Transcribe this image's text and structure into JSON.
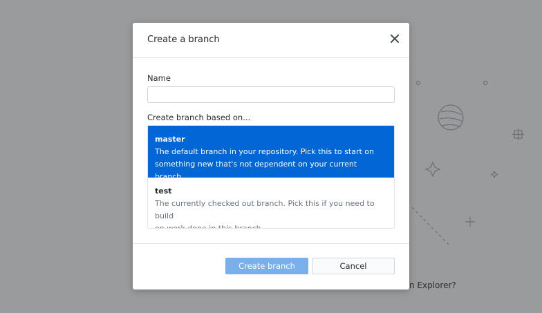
{
  "background": {
    "partial_text": "n Explorer?"
  },
  "dialog": {
    "title": "Create a branch",
    "close_icon": "close-icon",
    "name_label": "Name",
    "name_value": "",
    "based_on_label": "Create branch based on...",
    "branches": [
      {
        "name": "master",
        "description_line1": "The default branch in your repository. Pick this to start on",
        "description_line2": "something new that's not dependent on your current branch.",
        "selected": true
      },
      {
        "name": "test",
        "description_line1": "The currently checked out branch. Pick this if you need to build",
        "description_line2": "on work done in this branch.",
        "selected": false
      }
    ],
    "primary_button": "Create branch",
    "secondary_button": "Cancel"
  },
  "colors": {
    "backdrop": "#9a9b9d",
    "selected_bg": "#0366d6",
    "primary_button_disabled": "#79b0ec"
  }
}
